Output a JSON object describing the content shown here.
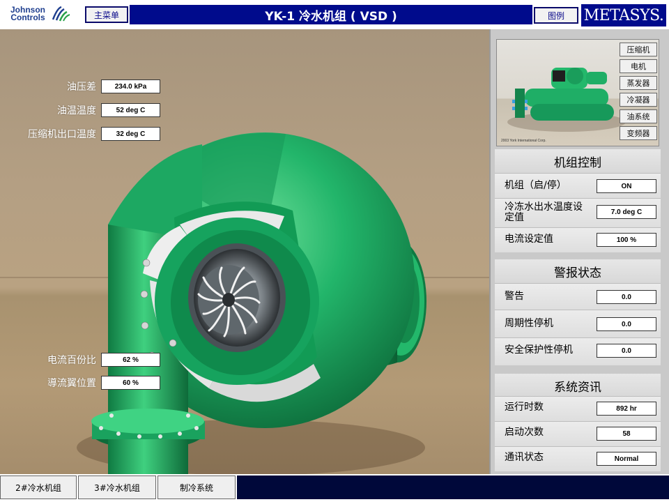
{
  "header": {
    "brand": {
      "line1": "Johnson",
      "line2": "Controls"
    },
    "main_menu_label": "主菜单",
    "title": "YK-1 冷水机组 ( VSD )",
    "legend_label": "图例",
    "metasys_logo": "METASYS."
  },
  "readouts": {
    "oil_pressure_diff": {
      "label": "油压差",
      "value": "234.0 kPa"
    },
    "oil_temp": {
      "label": "油温温度",
      "value": "52 deg C"
    },
    "compressor_outlet_temp": {
      "label": "压缩机出口温度",
      "value": "32 deg C"
    },
    "current_percent": {
      "label": "电流百份比",
      "value": "62 %"
    },
    "vane_position": {
      "label": "導流翼位置",
      "value": "60 %"
    }
  },
  "components": {
    "buttons": [
      "压缩机",
      "电机",
      "蒸发器",
      "冷凝器",
      "油系统",
      "变频器"
    ],
    "copyright": "2003 York International Corp."
  },
  "unit_control": {
    "title": "机组控制",
    "rows": [
      {
        "label": "机组（启/停）",
        "value": "ON"
      },
      {
        "label": "冷冻水出水温度设定值",
        "value": "7.0 deg C"
      },
      {
        "label": "电流设定值",
        "value": "100 %"
      }
    ]
  },
  "alarm_status": {
    "title": "警报状态",
    "rows": [
      {
        "label": "警告",
        "value": "0.0"
      },
      {
        "label": "周期性停机",
        "value": "0.0"
      },
      {
        "label": "安全保护性停机",
        "value": "0.0"
      }
    ]
  },
  "system_info": {
    "title": "系统资讯",
    "rows": [
      {
        "label": "运行时数",
        "value": "892 hr"
      },
      {
        "label": "启动次数",
        "value": "58"
      },
      {
        "label": "通讯状态",
        "value": "Normal"
      }
    ]
  },
  "bottom_nav": [
    "2#冷水机组",
    "3#冷水机组",
    "制冷系统"
  ],
  "colors": {
    "title_bar": "#000b8c",
    "casing_green": "#1fb36a",
    "panel_gray": "#c9c9c9"
  }
}
